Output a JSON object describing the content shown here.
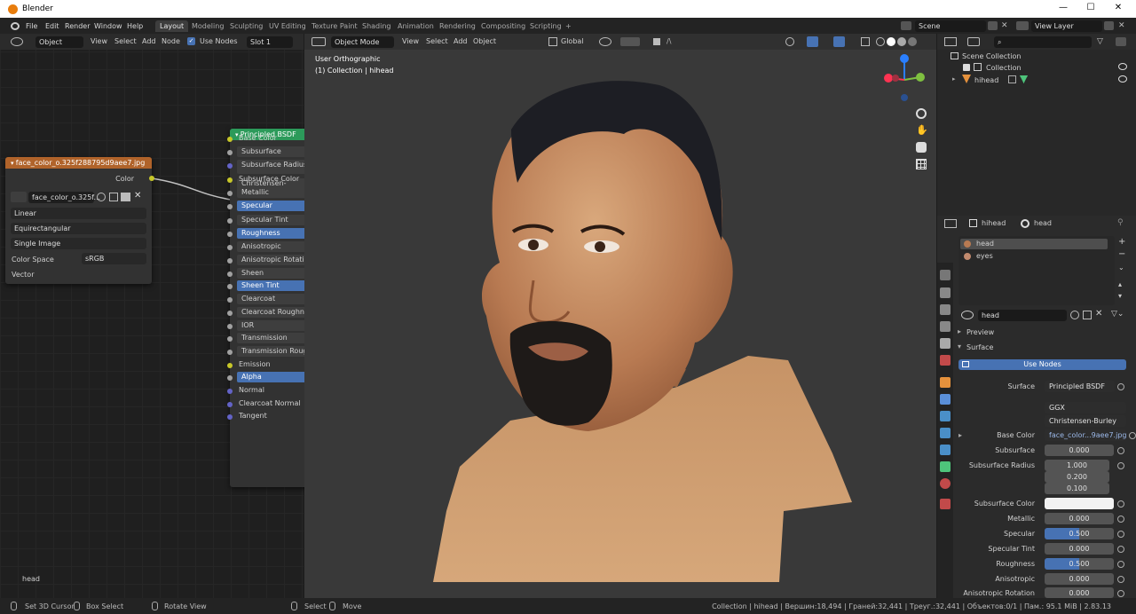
{
  "window": {
    "title": "Blender",
    "minimize": "—",
    "maximize": "☐",
    "close": "✕"
  },
  "menubar": {
    "items": [
      "File",
      "Edit",
      "Render",
      "Window",
      "Help"
    ],
    "workspaces": [
      "Layout",
      "Modeling",
      "Sculpting",
      "UV Editing",
      "Texture Paint",
      "Shading",
      "Animation",
      "Rendering",
      "Compositing",
      "Scripting"
    ],
    "active_workspace": "Layout",
    "add_tab": "+",
    "scene": "Scene",
    "view_layer": "View Layer"
  },
  "node_editor": {
    "header": {
      "mode": "Object",
      "view": "View",
      "select": "Select",
      "add": "Add",
      "node": "Node",
      "use_nodes": "Use Nodes",
      "slot": "Slot 1"
    },
    "image_node": {
      "title": "face_color_o.325f288795d9aee7.jpg",
      "output": "Color",
      "image_name": "face_color_o.325f...",
      "interpolation": "Linear",
      "projection": "Equirectangular",
      "extension": "Single Image",
      "color_space_label": "Color Space",
      "color_space": "sRGB",
      "vector": "Vector"
    },
    "bsdf_node": {
      "title": "Principled BSDF",
      "distribution": "GGX",
      "subsurface_method": "Christensen-Burley",
      "inputs": [
        {
          "label": "Base Color",
          "style": "plain",
          "socket": "yellow"
        },
        {
          "label": "Subsurface",
          "style": "box",
          "socket": "gray"
        },
        {
          "label": "Subsurface Radius",
          "style": "box",
          "socket": "purple"
        },
        {
          "label": "Subsurface Color",
          "style": "plain",
          "socket": "yellow"
        },
        {
          "label": "Metallic",
          "style": "box",
          "socket": "gray"
        },
        {
          "label": "Specular",
          "style": "blue",
          "socket": "gray"
        },
        {
          "label": "Specular Tint",
          "style": "box",
          "socket": "gray"
        },
        {
          "label": "Roughness",
          "style": "blue",
          "socket": "gray"
        },
        {
          "label": "Anisotropic",
          "style": "box",
          "socket": "gray"
        },
        {
          "label": "Anisotropic Rotation",
          "style": "box",
          "socket": "gray"
        },
        {
          "label": "Sheen",
          "style": "box",
          "socket": "gray"
        },
        {
          "label": "Sheen Tint",
          "style": "blue",
          "socket": "gray"
        },
        {
          "label": "Clearcoat",
          "style": "box",
          "socket": "gray"
        },
        {
          "label": "Clearcoat Roughness",
          "style": "box",
          "socket": "gray"
        },
        {
          "label": "IOR",
          "style": "box",
          "socket": "gray"
        },
        {
          "label": "Transmission",
          "style": "box",
          "socket": "gray"
        },
        {
          "label": "Transmission Roughness",
          "style": "box",
          "socket": "gray"
        },
        {
          "label": "Emission",
          "style": "plain",
          "socket": "yellow"
        },
        {
          "label": "Alpha",
          "style": "blue",
          "socket": "gray"
        },
        {
          "label": "Normal",
          "style": "plain",
          "socket": "purple"
        },
        {
          "label": "Clearcoat Normal",
          "style": "plain",
          "socket": "purple"
        },
        {
          "label": "Tangent",
          "style": "plain",
          "socket": "purple"
        }
      ]
    },
    "footer_label": "head"
  },
  "viewport": {
    "header": {
      "mode": "Object Mode",
      "view": "View",
      "select": "Select",
      "add": "Add",
      "object": "Object",
      "orientation": "Global"
    },
    "overlay_title": "User Orthographic",
    "overlay_subtitle": "(1) Collection | hihead",
    "gizmo": {
      "z": "Z",
      "y": "Y",
      "x": "X"
    }
  },
  "outliner": {
    "search_placeholder": "",
    "scene_collection": "Scene Collection",
    "collection": "Collection",
    "object": "hihead"
  },
  "properties": {
    "object_name": "hihead",
    "material_name": "head",
    "slots": [
      "head",
      "eyes"
    ],
    "material_field": "head",
    "preview_label": "Preview",
    "surface_label": "Surface",
    "use_nodes_button": "Use Nodes",
    "surface_shader_label": "Surface",
    "surface_shader": "Principled BSDF",
    "distribution": "GGX",
    "subsurface_method": "Christensen-Burley",
    "base_color_label": "Base Color",
    "base_color_value": "face_color...9aee7.jpg",
    "fields": {
      "subsurface": {
        "label": "Subsurface",
        "value": "0.000"
      },
      "subsurface_radius": {
        "label": "Subsurface Radius",
        "values": [
          "1.000",
          "0.200",
          "0.100"
        ]
      },
      "subsurface_color": {
        "label": "Subsurface Color"
      },
      "metallic": {
        "label": "Metallic",
        "value": "0.000"
      },
      "specular": {
        "label": "Specular",
        "value": "0.500",
        "fill": 0.5
      },
      "specular_tint": {
        "label": "Specular Tint",
        "value": "0.000"
      },
      "roughness": {
        "label": "Roughness",
        "value": "0.500",
        "fill": 0.5
      },
      "anisotropic": {
        "label": "Anisotropic",
        "value": "0.000"
      },
      "anisotropic_rotation": {
        "label": "Anisotropic Rotation",
        "value": "0.000"
      }
    }
  },
  "statusbar": {
    "set_cursor": "Set 3D Cursor",
    "box_select": "Box Select",
    "rotate_view": "Rotate View",
    "select": "Select",
    "move": "Move",
    "stats": "Collection | hihead | Вершин:18,494 | Граней:32,441 | Треуг.:32,441 | Объектов:0/1 | Пам.: 95.1 MiB | 2.83.13"
  },
  "colors": {
    "accent": "#4772b3",
    "image_node_header": "#b0632a",
    "bsdf_node_header": "#2c9a5a",
    "titlebar": "#ffffff"
  }
}
